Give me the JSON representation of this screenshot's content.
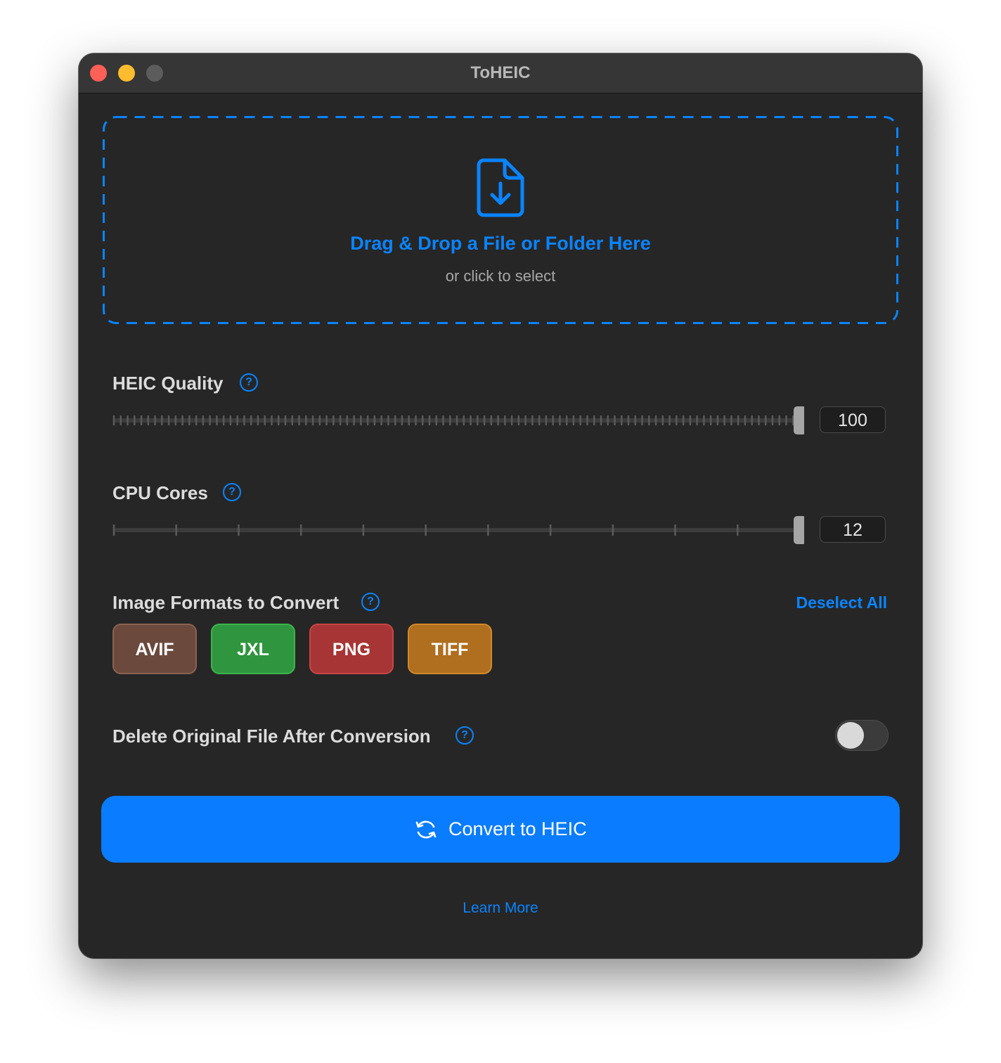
{
  "window": {
    "title": "ToHEIC"
  },
  "dropzone": {
    "title": "Drag & Drop a File or Folder Here",
    "subtitle": "or click to select",
    "icon": "document-download-icon"
  },
  "quality": {
    "label": "HEIC Quality",
    "value": "100",
    "min": 0,
    "max": 100,
    "level": 100
  },
  "cores": {
    "label": "CPU Cores",
    "value": "12",
    "min": 1,
    "max": 12,
    "level": 12
  },
  "formats": {
    "label": "Image Formats to Convert",
    "deselect_label": "Deselect All",
    "items": [
      {
        "label": "AVIF",
        "color": "#6b4a3d",
        "border": "#8a6252"
      },
      {
        "label": "JXL",
        "color": "#2f953e",
        "border": "#3cb54e"
      },
      {
        "label": "PNG",
        "color": "#a83535",
        "border": "#c94545"
      },
      {
        "label": "TIFF",
        "color": "#b06f1e",
        "border": "#d18a2a"
      }
    ]
  },
  "delete_original": {
    "label": "Delete Original File After Conversion",
    "enabled": false
  },
  "help_symbol": "?",
  "convert": {
    "label": "Convert to HEIC",
    "icon": "refresh-icon"
  },
  "learn_more": "Learn More",
  "colors": {
    "accent": "#0a84ff",
    "background": "#262626"
  }
}
